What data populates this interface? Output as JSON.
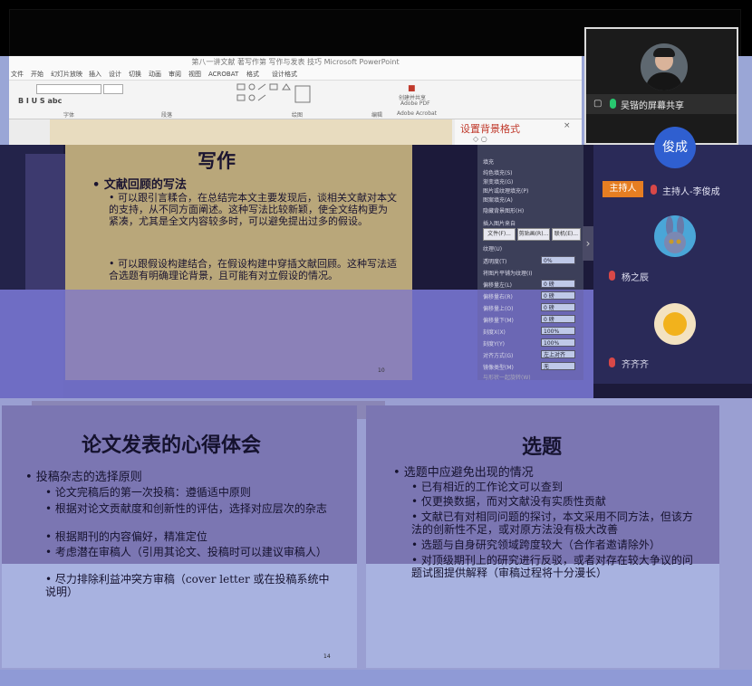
{
  "ppt": {
    "title": "第八一讲文献 著写作第 写作与发表 技巧  Microsoft PowerPoint",
    "tabs": [
      "文件",
      "开始",
      "幻灯片放映",
      "插入",
      "设计",
      "切换",
      "动画",
      "审阅",
      "视图",
      "ACROBAT",
      "格式",
      "设计格式"
    ],
    "ribbon_groups": [
      "字体",
      "段落",
      "绘图",
      "编辑",
      "Adobe Acrobat"
    ],
    "ribbon_misc": [
      "创建并共享",
      "Adobe PDF"
    ],
    "format_pane_title": "设置背景格式"
  },
  "main_slide": {
    "heading": "写作",
    "bullet1": "• 文献回顾的写法",
    "sub1": "• 可以跟引言糅合，在总结完本文主要发现后，谈相关文献对本文的支持，从不同方面阐述。这种写法比较新颖，使全文结构更为紧凑，尤其是全文内容较多时，可以避免提出过多的假设。",
    "sub2": "• 可以跟假设构建结合，在假设构建中穿插文献回顾。这种写法适合选题有明确理论背景，且可能有对立假设的情况。",
    "page": "10"
  },
  "format_pane": {
    "section": "填充",
    "options": [
      "纯色填充(S)",
      "渐变填充(G)",
      "图片或纹理填充(P)",
      "图案填充(A)",
      "隐藏背景图形(H)"
    ],
    "insert_from": "插入图片来自",
    "buttons": [
      "文件(F)...",
      "剪贴画(R)...",
      "联机(E)..."
    ],
    "texture": "纹理(U)",
    "transparency": "透明度(T)",
    "transparency_val": "0%",
    "tile": "将图片平铺为纹理(I)",
    "offsets": [
      {
        "label": "偏移量左(L)",
        "val": "0 磅"
      },
      {
        "label": "偏移量右(R)",
        "val": "0 磅"
      },
      {
        "label": "偏移量上(O)",
        "val": "0 磅"
      },
      {
        "label": "偏移量下(M)",
        "val": "0 磅"
      },
      {
        "label": "刻度X(X)",
        "val": "100%"
      },
      {
        "label": "刻度Y(Y)",
        "val": "100%"
      }
    ],
    "align": "对齐方式(G)",
    "align_val": "左上对齐",
    "mirror": "镜像类型(M)",
    "mirror_val": "无",
    "rotate": "与形状一起旋转(W)"
  },
  "participants": {
    "share_label": "吴锴的屏幕共享",
    "host_avatar_text": "俊成",
    "host_tag": "主持人",
    "host_name": "主持人-李俊成",
    "p2_name": "杨之辰",
    "p3_name": "齐齐齐"
  },
  "slide_a": {
    "title": "论文发表的心得体会",
    "bullet": "• 投稿杂志的选择原则",
    "items": [
      "• 论文完稿后的第一次投稿：遵循适中原则",
      "• 根据对论文贡献度和创新性的评估，选择对应层次的杂志",
      "• 根据期刊的内容偏好，精准定位",
      "• 考虑潜在审稿人（引用其论文、投稿时可以建议审稿人）",
      "• 尽力排除利益冲突方审稿（cover letter 或在投稿系统中说明）"
    ],
    "page": "14"
  },
  "slide_b": {
    "title": "选题",
    "bullet": "• 选题中应避免出现的情况",
    "items": [
      "• 已有相近的工作论文可以查到",
      "• 仅更换数据，而对文献没有实质性贡献",
      "• 文献已有对相同问题的探讨，本文采用不同方法，但该方法的创新性不足，或对原方法没有极大改善",
      "• 选题与自身研究领域跨度较大（合作者邀请除外）",
      "• 对顶级期刊上的研究进行反驳，或者对存在较大争议的问题试图提供解释（审稿过程将十分漫长）"
    ]
  }
}
